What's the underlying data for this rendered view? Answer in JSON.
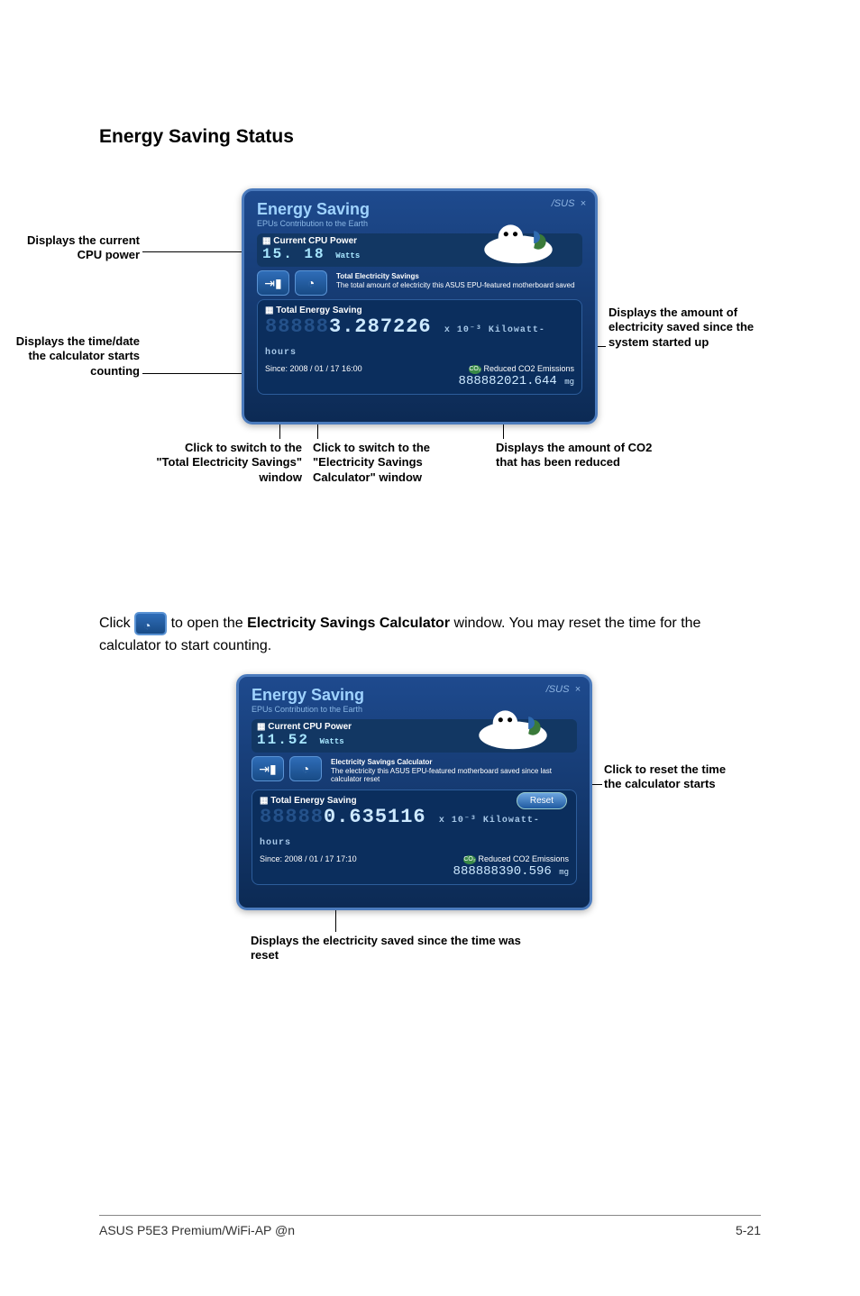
{
  "heading": "Energy Saving Status",
  "panel1": {
    "title": "Energy Saving",
    "subtitle": "EPUs Contribution to the Earth",
    "cpu_label": "Current CPU Power",
    "cpu_value": "15. 18",
    "cpu_unit": "Watts",
    "tes_title": "Total Electricity Savings",
    "tes_desc": "The total amount of electricity this ASUS EPU-featured motherboard saved",
    "tes_header": "Total Energy Saving",
    "big_value": "3.287226",
    "big_exp": "x 10⁻³",
    "big_unit": "Kilowatt-hours",
    "since": "Since: 2008 / 01 / 17 16:00",
    "co2_label": "Reduced CO2 Emissions",
    "co2_value": "2021.644",
    "co2_unit": "mg",
    "brand": "/SUS",
    "close": "×"
  },
  "callouts1": {
    "a": "Displays the current CPU power",
    "b": "Displays the time/date the calculator starts counting",
    "c": "Click to switch to the \"Total Electricity Savings\" window",
    "d": "Click to switch to the \"Electricity Savings Calculator\" window",
    "e": "Displays the amount of CO2 that has been reduced",
    "f": "Displays the amount of electricity saved since the system started up"
  },
  "mid_text": {
    "pre": "Click ",
    "post": " to open the ",
    "bold": "Electricity Savings Calculator",
    "tail": " window. You may reset the time for the calculator to start counting."
  },
  "panel2": {
    "title": "Energy Saving",
    "subtitle": "EPUs Contribution to the Earth",
    "cpu_label": "Current CPU Power",
    "cpu_value": "11.52",
    "cpu_unit": "Watts",
    "esc_title": "Electricity Savings Calculator",
    "esc_desc": "The electricity this ASUS EPU-featured motherboard saved since last calculator reset",
    "tes_header": "Total Energy Saving",
    "reset": "Reset",
    "big_value": "0.635116",
    "big_exp": "x 10⁻³",
    "big_unit": "Kilowatt-hours",
    "since": "Since: 2008 / 01 / 17 17:10",
    "co2_label": "Reduced CO2 Emissions",
    "co2_value": "390.596",
    "co2_unit": "mg",
    "brand": "/SUS",
    "close": "×"
  },
  "callouts2": {
    "reset": "Click to reset the time the calculator starts",
    "since": "Displays the electricity saved since the time was reset"
  },
  "footer": {
    "left": "ASUS P5E3 Premium/WiFi-AP @n",
    "right": "5-21"
  }
}
